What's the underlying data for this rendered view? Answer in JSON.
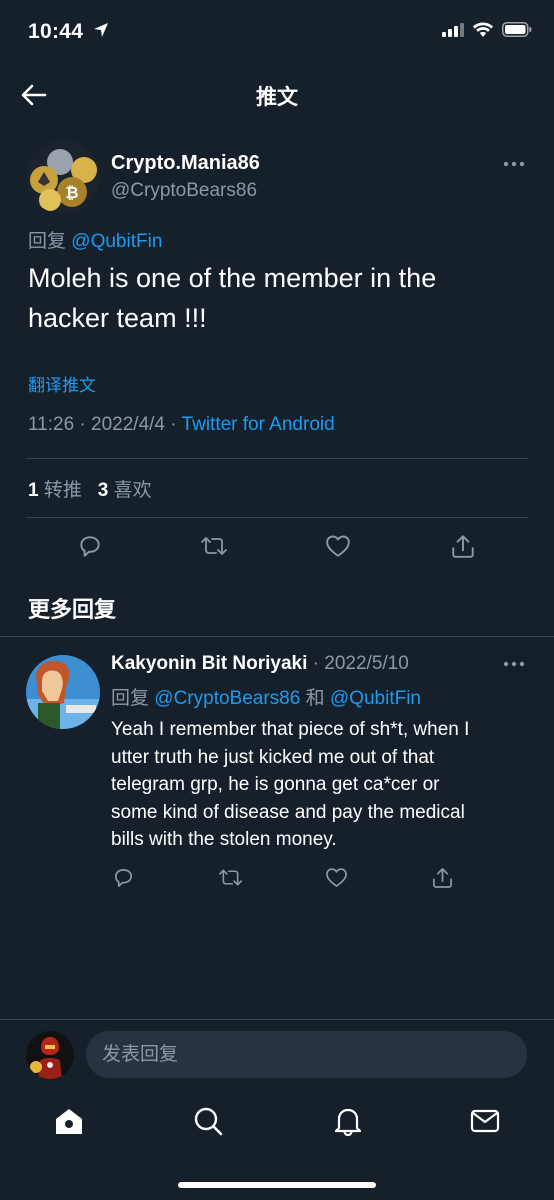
{
  "status_bar": {
    "time": "10:44"
  },
  "header": {
    "title": "推文"
  },
  "tweet": {
    "author_name": "Crypto.Mania86",
    "author_handle": "@CryptoBears86",
    "reply_prefix": "回复",
    "reply_to": "@QubitFin",
    "text_line1": "Moleh is one of the member in the",
    "text_line2": "hacker team !!!",
    "translate_label": "翻译推文",
    "time": "11:26",
    "separator": "·",
    "date": "2022/4/4",
    "source": "Twitter for Android",
    "retweet_count": "1",
    "retweet_label": "转推",
    "like_count": "3",
    "like_label": "喜欢"
  },
  "more_replies_title": "更多回复",
  "reply": {
    "author_name": "Kakyonin Bit Noriyaki",
    "separator": "·",
    "date": "2022/5/10",
    "reply_prefix": "回复",
    "reply_to_1": "@CryptoBears86",
    "conjunction": "和",
    "reply_to_2": "@QubitFin",
    "text_line1": "Yeah I remember that piece of sh*t, when I",
    "text_line2": "utter truth he just kicked me out of that",
    "text_line3": "telegram grp, he is gonna get ca*cer or",
    "text_line4": "some kind of disease and pay the medical",
    "text_line5": "bills with the stolen money."
  },
  "composer": {
    "placeholder": "发表回复"
  },
  "colors": {
    "background": "#15202b",
    "accent": "#1d9bf0",
    "secondary_text": "#8b98a5",
    "divider": "#38444d"
  },
  "icons": {
    "status": [
      "location-arrow-icon",
      "signal-icon",
      "wifi-icon",
      "battery-icon"
    ],
    "tweet_actions": [
      "reply-icon",
      "retweet-icon",
      "like-icon",
      "share-icon"
    ],
    "bottom_nav": [
      "home-icon",
      "search-icon",
      "notifications-icon",
      "messages-icon"
    ]
  }
}
